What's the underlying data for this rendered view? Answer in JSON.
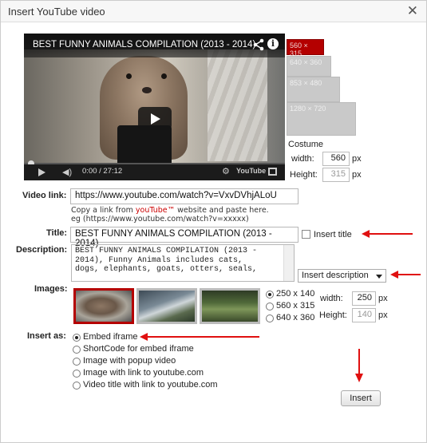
{
  "dialog": {
    "title": "Insert YouTube video",
    "close_glyph": "✕"
  },
  "video": {
    "title": "BEST FUNNY ANIMALS COMPILATION (2013 - 2014)",
    "time": "0:00 / 27:12",
    "brand": "YouTube",
    "info_glyph": "i",
    "volume_glyph": "◀)",
    "gear_glyph": "⚙"
  },
  "sizes": [
    {
      "label": "560 × 315",
      "active": true
    },
    {
      "label": "640 × 360",
      "active": false
    },
    {
      "label": "853 × 480",
      "active": false
    },
    {
      "label": "1280 × 720",
      "active": false
    }
  ],
  "costume": {
    "heading": "Costume",
    "width_label": "width:",
    "width_value": "560",
    "height_label": "Height:",
    "height_value": "315",
    "unit": "px"
  },
  "video_link": {
    "label": "Video link:",
    "value": "https://www.youtube.com/watch?v=VxvDVhjALoU",
    "help_prefix": "Copy a link from ",
    "help_brand": "youTube™",
    "help_suffix": " website and paste here.",
    "help_example": "eg (https://www.youtube.com/watch?v=xxxxx)"
  },
  "title_field": {
    "label": "Title:",
    "value": "BEST FUNNY ANIMALS COMPILATION (2013 - 2014)",
    "checkbox_label": "Insert title"
  },
  "description": {
    "label": "Description:",
    "value": "BEST FUNNY ANIMALS COMPILATION (2013 -\n2014), Funny Animals includes cats,\ndogs, elephants, goats, otters, seals,",
    "select_value": "Insert description"
  },
  "images": {
    "label": "Images:",
    "sizes": [
      {
        "label": "250 x 140",
        "checked": true
      },
      {
        "label": "560 x 315",
        "checked": false
      },
      {
        "label": "640 x 360",
        "checked": false
      }
    ],
    "width_label": "width:",
    "width_value": "250",
    "height_label": "Height:",
    "height_value": "140",
    "unit": "px"
  },
  "insert_as": {
    "label": "Insert as:",
    "options": [
      {
        "label": "Embed iframe",
        "checked": true
      },
      {
        "label": "ShortCode for embed iframe",
        "checked": false
      },
      {
        "label": "Image with popup video",
        "checked": false
      },
      {
        "label": "Image with link to youtube.com",
        "checked": false
      },
      {
        "label": "Video title with link to youtube.com",
        "checked": false
      }
    ]
  },
  "insert_button": "Insert",
  "colors": {
    "accent_red": "#b40000",
    "arrow_red": "#e01010"
  }
}
